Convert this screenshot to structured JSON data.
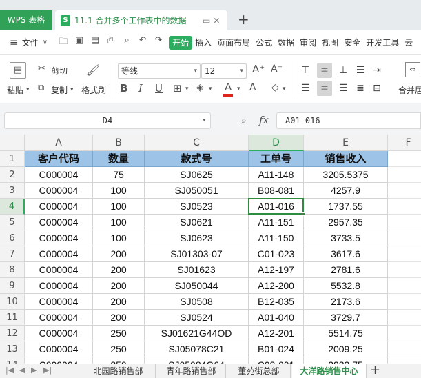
{
  "titlebar": {
    "app_tab": "WPS 表格",
    "doc_icon": "S",
    "doc_title": "11.1 合并多个工作表中的数据",
    "new_tab": "+"
  },
  "menubar": {
    "file_label": "文件",
    "items": [
      "开始",
      "插入",
      "页面布局",
      "公式",
      "数据",
      "审阅",
      "视图",
      "安全",
      "开发工具",
      "云"
    ],
    "active_index": 0
  },
  "ribbon": {
    "paste_label": "粘贴",
    "cut_label": "剪切",
    "copy_label": "复制",
    "format_painter_label": "格式刷",
    "font_name": "等线",
    "font_size": "12",
    "merge_label": "合并居"
  },
  "formula_bar": {
    "cell_ref": "D4",
    "formula": "A01-016"
  },
  "sheet": {
    "columns": [
      "A",
      "B",
      "C",
      "D",
      "E",
      "F"
    ],
    "selected_column": "D",
    "selected_row": 4,
    "header_row": [
      "客户代码",
      "数量",
      "款式号",
      "工单号",
      "销售收入"
    ],
    "rows": [
      [
        "C000004",
        "75",
        "SJ0625",
        "A11-148",
        "3205.5375"
      ],
      [
        "C000004",
        "100",
        "SJ050051",
        "B08-081",
        "4257.9"
      ],
      [
        "C000004",
        "100",
        "SJ0523",
        "A01-016",
        "1737.55"
      ],
      [
        "C000004",
        "100",
        "SJ0621",
        "A11-151",
        "2957.35"
      ],
      [
        "C000004",
        "100",
        "SJ0623",
        "A11-150",
        "3733.5"
      ],
      [
        "C000004",
        "200",
        "SJ01303-07",
        "C01-023",
        "3617.6"
      ],
      [
        "C000004",
        "200",
        "SJ01623",
        "A12-197",
        "2781.6"
      ],
      [
        "C000004",
        "200",
        "SJ050044",
        "A12-200",
        "5532.8"
      ],
      [
        "C000004",
        "200",
        "SJ0508",
        "B12-035",
        "2173.6"
      ],
      [
        "C000004",
        "200",
        "SJ0524",
        "A01-040",
        "3729.7"
      ],
      [
        "C000004",
        "250",
        "SJ01621G44OD",
        "A12-201",
        "5514.75"
      ],
      [
        "C000004",
        "250",
        "SJ05078C21",
        "B01-024",
        "2009.25"
      ],
      [
        "C000004",
        "250",
        "SJ05084G64",
        "C02-001",
        "2223.75"
      ]
    ]
  },
  "sheet_tabs": {
    "tabs": [
      "北园路销售部",
      "青年路销售部",
      "董苑街总部",
      "大洋路销售中心"
    ],
    "active_index": 3,
    "add_label": "+"
  }
}
